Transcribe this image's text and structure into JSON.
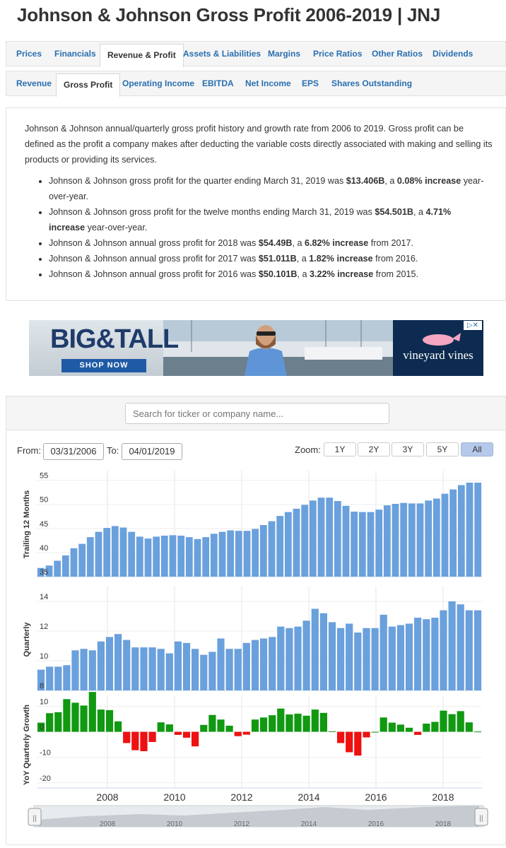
{
  "page_title": "Johnson & Johnson Gross Profit 2006-2019 | JNJ",
  "main_tabs": [
    "Prices",
    "Financials",
    "Revenue & Profit",
    "Assets & Liabilities",
    "Margins",
    "Price Ratios",
    "Other Ratios",
    "Dividends"
  ],
  "sub_tabs": [
    "Revenue",
    "Gross Profit",
    "Operating Income",
    "EBITDA",
    "Net Income",
    "EPS",
    "Shares Outstanding"
  ],
  "description": "Johnson & Johnson annual/quarterly gross profit history and growth rate from 2006 to 2019. Gross profit can be defined as the profit a company makes after deducting the variable costs directly associated with making and selling its products or providing its services.",
  "bullets": [
    {
      "pre": "Johnson & Johnson gross profit for the quarter ending March 31, 2019 was ",
      "v1": "$13.406B",
      "mid": ", a ",
      "v2": "0.08% increase",
      "post": " year-over-year."
    },
    {
      "pre": "Johnson & Johnson gross profit for the twelve months ending March 31, 2019 was ",
      "v1": "$54.501B",
      "mid": ", a ",
      "v2": "4.71% increase",
      "post": " year-over-year."
    },
    {
      "pre": "Johnson & Johnson annual gross profit for 2018 was ",
      "v1": "$54.49B",
      "mid": ", a ",
      "v2": "6.82% increase",
      "post": " from 2017."
    },
    {
      "pre": "Johnson & Johnson annual gross profit for 2017 was ",
      "v1": "$51.011B",
      "mid": ", a ",
      "v2": "1.82% increase",
      "post": " from 2016."
    },
    {
      "pre": "Johnson & Johnson annual gross profit for 2016 was ",
      "v1": "$50.101B",
      "mid": ", a ",
      "v2": "3.22% increase",
      "post": " from 2015."
    }
  ],
  "ad": {
    "headline": "BIG&TALL",
    "cta": "SHOP NOW",
    "brand": "vineyard vines",
    "adchoices": "▷✕"
  },
  "search": {
    "placeholder": "Search for ticker or company name..."
  },
  "range": {
    "from_label": "From:",
    "from": "03/31/2006",
    "to_label": "To:",
    "to": "04/01/2019",
    "zoom_label": "Zoom:",
    "zoom_options": [
      "1Y",
      "2Y",
      "3Y",
      "5Y",
      "All"
    ],
    "zoom_selected": "All"
  },
  "colors": {
    "bar_blue": "#6aa0dc",
    "growth_pos": "#119911",
    "growth_neg": "#ee1111",
    "tab_link": "#2a6fb0"
  },
  "chart_data": [
    {
      "type": "bar",
      "ylabel": "Trailing 12 Months",
      "yticks": [
        35,
        40,
        45,
        50,
        55
      ],
      "ylim": [
        35,
        57
      ],
      "values": [
        36.8,
        37.3,
        38.3,
        39.4,
        40.9,
        41.8,
        43.2,
        44.3,
        45.1,
        45.5,
        45.2,
        44.3,
        43.3,
        42.9,
        43.3,
        43.5,
        43.6,
        43.5,
        43.2,
        42.8,
        43.2,
        43.9,
        44.3,
        44.6,
        44.5,
        44.5,
        44.9,
        45.7,
        46.5,
        47.6,
        48.4,
        49.1,
        49.9,
        50.8,
        51.4,
        51.4,
        50.7,
        49.7,
        48.5,
        48.4,
        48.4,
        48.9,
        49.8,
        50.1,
        50.3,
        50.2,
        50.2,
        50.8,
        51.2,
        52.2,
        53.1,
        54.0,
        54.5,
        54.5
      ]
    },
    {
      "type": "bar",
      "ylabel": "Quarterly",
      "yticks": [
        8,
        10,
        12,
        14
      ],
      "ylim": [
        8,
        15
      ],
      "values": [
        9.4,
        9.6,
        9.6,
        9.7,
        10.7,
        10.8,
        10.7,
        11.3,
        11.6,
        11.8,
        11.4,
        10.9,
        10.9,
        10.9,
        10.8,
        10.5,
        11.3,
        11.2,
        10.8,
        10.4,
        10.6,
        11.5,
        10.8,
        10.8,
        11.2,
        11.4,
        11.5,
        11.6,
        12.3,
        12.2,
        12.3,
        12.7,
        13.5,
        13.2,
        12.6,
        12.2,
        12.5,
        11.9,
        12.2,
        12.2,
        13.1,
        12.3,
        12.4,
        12.5,
        12.9,
        12.8,
        12.9,
        13.4,
        14.0,
        13.8,
        13.4,
        13.4
      ]
    },
    {
      "type": "bar",
      "ylabel": "YoY Quarterly Growth",
      "yticks": [
        -20,
        -10,
        0,
        10
      ],
      "ylim": [
        -22,
        14
      ],
      "values": [
        3.6,
        7.3,
        7.7,
        12.8,
        11.4,
        10.3,
        15.6,
        8.7,
        8.5,
        4.1,
        -4.4,
        -7.2,
        -7.6,
        -4.0,
        3.7,
        2.9,
        -1.2,
        -2.3,
        -5.7,
        2.7,
        6.6,
        4.8,
        2.4,
        -1.7,
        -1.1,
        4.8,
        5.6,
        6.5,
        9.1,
        6.8,
        7.1,
        6.3,
        8.7,
        7.4,
        0.2,
        -4.4,
        -8.0,
        -9.3,
        -2.2,
        0.0,
        5.6,
        3.6,
        2.8,
        1.6,
        -1.2,
        3.2,
        3.9,
        8.3,
        6.9,
        8.1,
        3.7,
        0.1
      ]
    }
  ],
  "x_axis": {
    "ticks": [
      "2008",
      "2010",
      "2012",
      "2014",
      "2016",
      "2018"
    ]
  },
  "navigator": {
    "ticks": [
      "2008",
      "2010",
      "2012",
      "2014",
      "2016",
      "2018"
    ],
    "left_handle": "||",
    "right_handle": "||"
  }
}
